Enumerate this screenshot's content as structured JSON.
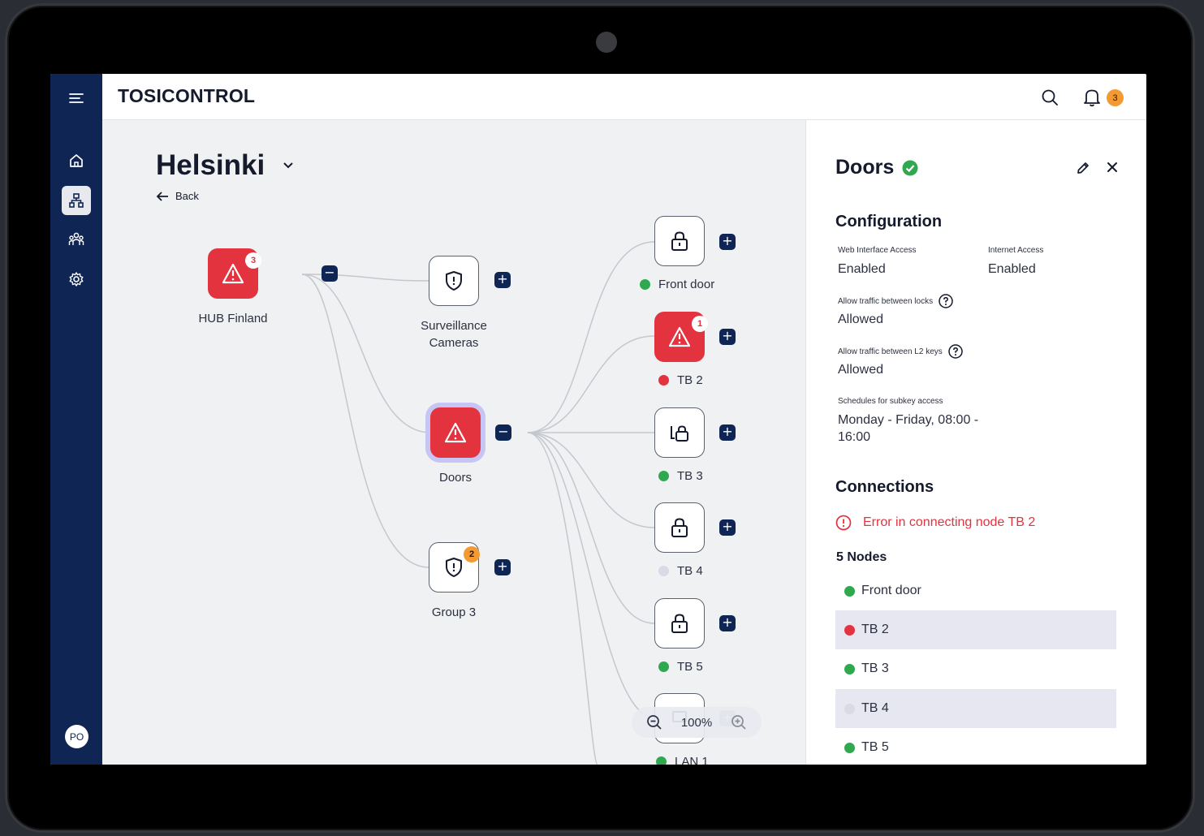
{
  "app": {
    "brand": "TOSICONTROL",
    "notification_count": "3",
    "user_initials": "PO"
  },
  "sidebar": {
    "items": [
      {
        "name": "menu-icon"
      },
      {
        "name": "home-icon"
      },
      {
        "name": "hierarchy-icon",
        "active": true
      },
      {
        "name": "users-icon"
      },
      {
        "name": "gear-icon"
      }
    ]
  },
  "canvas": {
    "location": "Helsinki",
    "back_label": "Back",
    "zoom": "100%",
    "nodes": {
      "hub": {
        "label": "HUB Finland",
        "alerts": "3"
      },
      "cameras": {
        "label_line1": "Surveillance",
        "label_line2": "Cameras"
      },
      "doors": {
        "label": "Doors"
      },
      "group3": {
        "label": "Group 3",
        "alerts": "2"
      },
      "front_door": {
        "label": "Front door",
        "status": "online"
      },
      "tb2": {
        "label": "TB 2",
        "status": "error",
        "alerts": "1"
      },
      "tb3": {
        "label": "TB 3",
        "status": "online"
      },
      "tb4": {
        "label": "TB 4",
        "status": "offline"
      },
      "tb5": {
        "label": "TB 5",
        "status": "online"
      },
      "lan1": {
        "label": "LAN 1",
        "status": "online"
      }
    }
  },
  "panel": {
    "title": "Doors",
    "configuration_heading": "Configuration",
    "web_access_label": "Web Interface Access",
    "web_access_value": "Enabled",
    "internet_label": "Internet Access",
    "internet_value": "Enabled",
    "traffic_locks_label": "Allow traffic between locks",
    "traffic_locks_value": "Allowed",
    "traffic_l2_label": "Allow traffic between L2 keys",
    "traffic_l2_value": "Allowed",
    "schedule_label": "Schedules for subkey access",
    "schedule_value_line1": "Monday - Friday, 08:00 -",
    "schedule_value_line2": "16:00",
    "connections_heading": "Connections",
    "error_text": "Error in connecting node TB 2",
    "nodes_count": "5 Nodes",
    "node_list": [
      {
        "label": "Front door",
        "status": "online"
      },
      {
        "label": "TB 2",
        "status": "error"
      },
      {
        "label": "TB 3",
        "status": "online"
      },
      {
        "label": "TB 4",
        "status": "offline"
      },
      {
        "label": "TB 5",
        "status": "online"
      }
    ]
  },
  "colors": {
    "navy": "#0f2553",
    "alert_red": "#e2333f",
    "online_green": "#2fa84f",
    "offline_grey": "#d9dae6",
    "badge_orange": "#f39a32"
  }
}
